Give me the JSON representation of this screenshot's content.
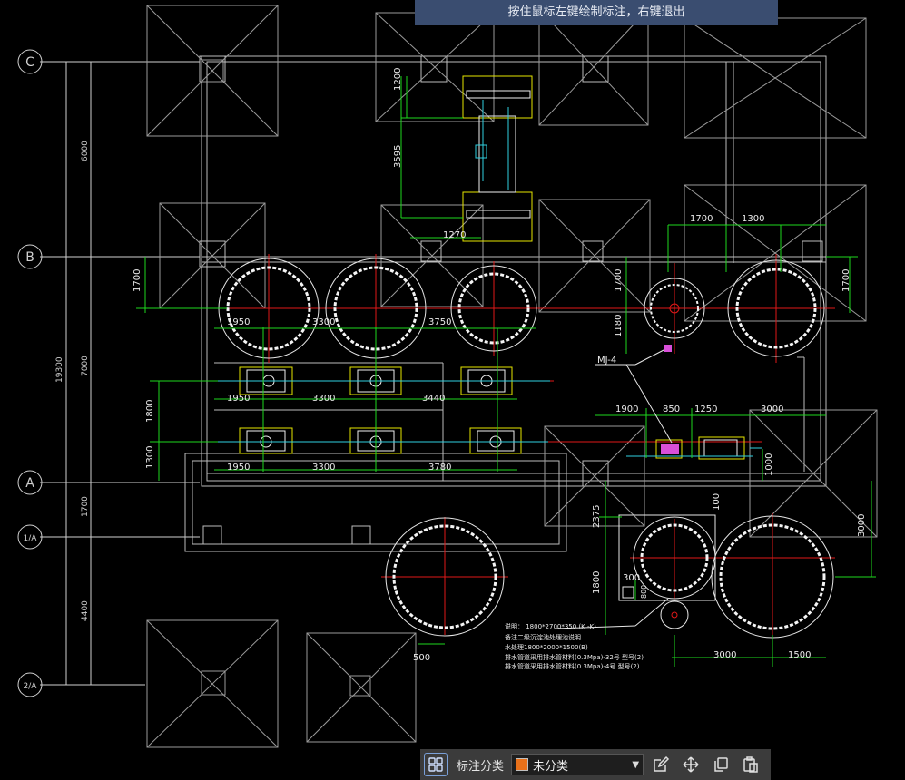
{
  "hint": "按住鼠标左键绘制标注，右键退出",
  "toolbar": {
    "category_label": "标注分类",
    "selected_category": "未分类",
    "selected_color": "#e8711a"
  },
  "axes": {
    "c": "C",
    "b": "B",
    "a": "A",
    "one_a": "1/A",
    "two_a": "2/A"
  },
  "dims": {
    "left_6000": "6000",
    "left_7000": "7000",
    "left_19300": "19300",
    "left_1700": "1700",
    "left_4400": "4400",
    "d1200": "1200",
    "d3595": "3595",
    "d1270": "1270",
    "d1700_a": "1700",
    "d1300_a": "1300",
    "d1700_v1": "1700",
    "d1700_v2": "1700",
    "d1700_v3": "1700",
    "r1_1": "1950",
    "r1_2": "3300",
    "r1_3": "3750",
    "r2_1": "1950",
    "r2_2": "3300",
    "r2_3": "3440",
    "r3_1": "1950",
    "r3_2": "3300",
    "r3_3": "3780",
    "d1800": "1800",
    "d1300": "1300",
    "d1180": "1180",
    "mj": "MJ-4",
    "d1900": "1900",
    "d850": "850",
    "d1250": "1250",
    "d3000": "3000",
    "d1000": "1000",
    "d2375": "2375",
    "d100": "100",
    "d1800b": "1800",
    "d300": "300",
    "d3000v": "3000",
    "d3000b": "3000",
    "d1500": "1500",
    "d500": "500",
    "d800": "800"
  },
  "notes": {
    "line1": "说明：  1800*2700*350    (K  -K) ",
    "line2": "备注二级沉淀池处理池说明",
    "line3": "水处理1800*2000*1500(B)",
    "line4": "排水管道采用排水管材料(0.3Mpa)-32号  型号(2)",
    "line5": "排水管道采用排水管材料(0.3Mpa)-4号  型号(2)"
  }
}
